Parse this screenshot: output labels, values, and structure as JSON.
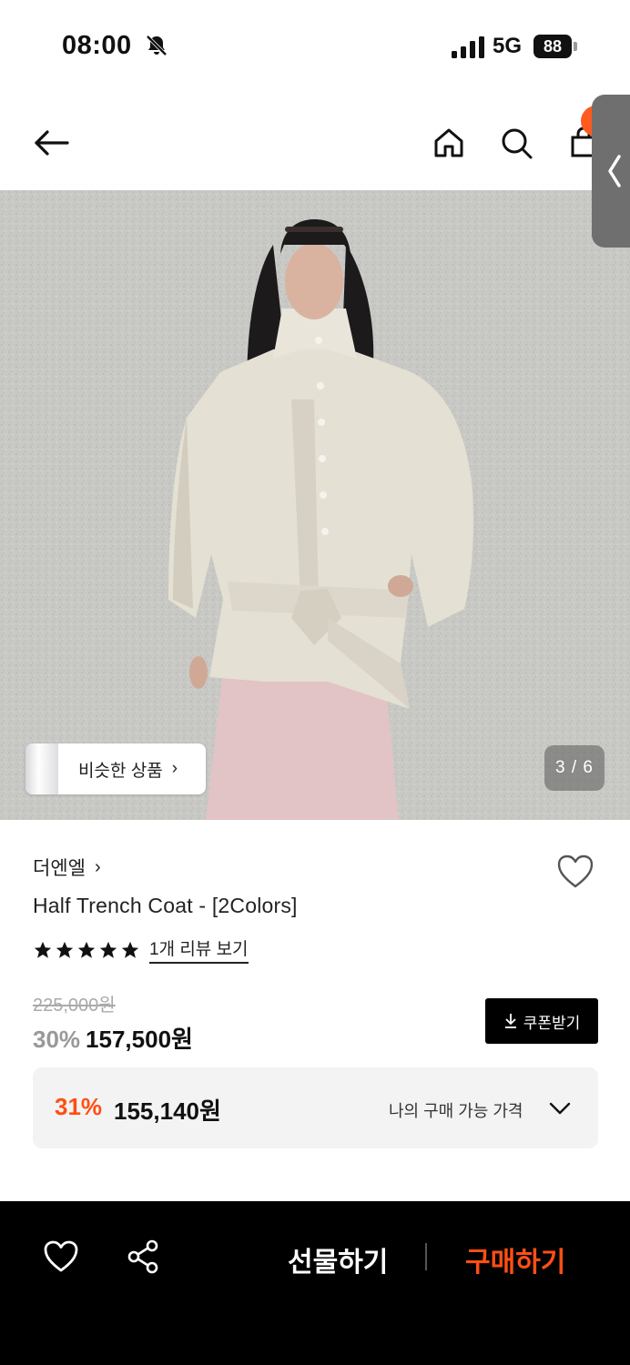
{
  "status_bar": {
    "time": "08:00",
    "network": "5G",
    "battery": "88",
    "icons": [
      "bell-off-icon",
      "signal-icon",
      "battery-icon"
    ]
  },
  "top_nav": {
    "icons": [
      "back-arrow-icon",
      "home-icon",
      "search-icon",
      "shopping-bag-icon",
      "side-panel-chevron-icon"
    ]
  },
  "gallery": {
    "similar_label": "비슷한 상품",
    "similar_chevron": "›",
    "page_indicator": "3 / 6"
  },
  "product": {
    "brand": "더엔엘",
    "brand_chevron": "›",
    "name": "Half Trench Coat - [2Colors]",
    "rating_stars": 5,
    "review_link": "1개 리뷰 보기",
    "original_price": "225,000원",
    "discount": "30%",
    "price": "157,500원",
    "coupon_label": "쿠폰받기"
  },
  "my_price": {
    "discount": "31%",
    "price": "155,140원",
    "label": "나의 구매 가능 가격"
  },
  "bottom_bar": {
    "gift_label": "선물하기",
    "buy_label": "구매하기"
  },
  "colors": {
    "accent": "#ff4f14",
    "badge": "#ff5a1f",
    "bottom_bar_bg": "#000000"
  }
}
